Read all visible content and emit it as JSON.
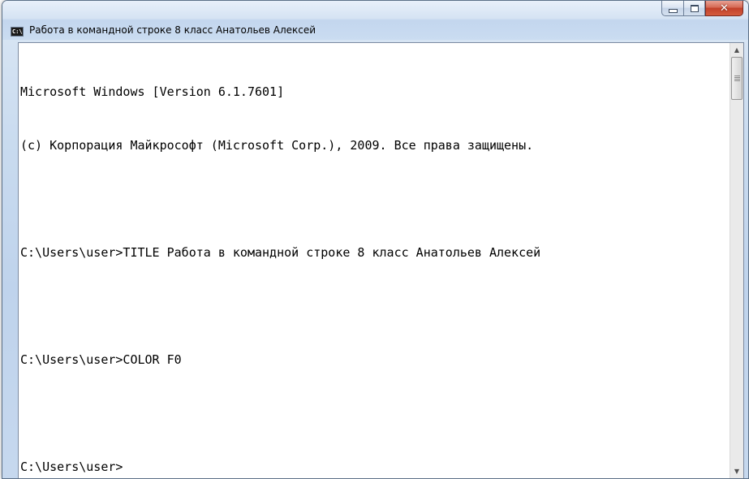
{
  "window": {
    "title": "Работа в командной строке 8 класс Анатольев Алексей",
    "icon_label": "C:\\.",
    "controls": {
      "minimize": "minimize",
      "maximize": "maximize",
      "close": "✕"
    }
  },
  "console": {
    "background": "#ffffff",
    "foreground": "#000000",
    "lines": [
      "Microsoft Windows [Version 6.1.7601]",
      "(c) Корпорация Майкрософт (Microsoft Corp.), 2009. Все права защищены.",
      "",
      "C:\\Users\\user>TITLE Работа в командной строке 8 класс Анатольев Алексей",
      "",
      "C:\\Users\\user>COLOR F0",
      "",
      "C:\\Users\\user>"
    ]
  },
  "scrollbar": {
    "up_arrow": "▲",
    "down_arrow": "▼"
  }
}
